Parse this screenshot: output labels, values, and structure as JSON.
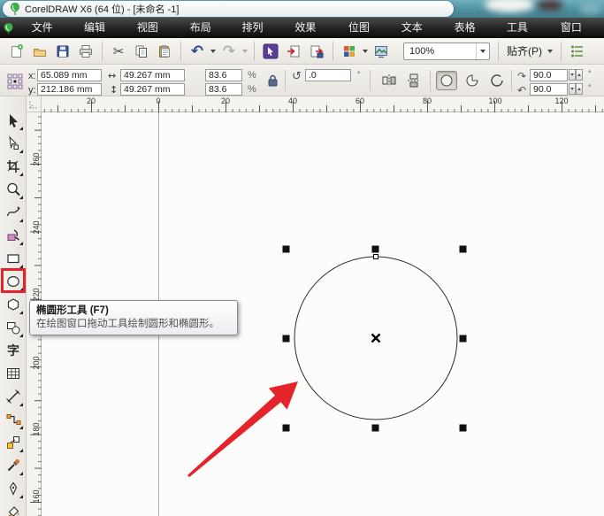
{
  "window": {
    "title": "CorelDRAW X6 (64 位) - [未命名 -1]"
  },
  "menu": {
    "items": [
      "文件(F)",
      "编辑(E)",
      "视图(V)",
      "布局(L)",
      "排列(A)",
      "效果(C)",
      "位图(B)",
      "文本(X)",
      "表格(T)",
      "工具(O)",
      "窗口(W)"
    ]
  },
  "toolbar": {
    "zoom_value": "100%",
    "snap_label": "贴齐(P)"
  },
  "icons": {
    "undo_glyph": "↶",
    "redo_glyph": "↷",
    "cut_glyph": "✂",
    "rotate_glyph": "↺",
    "angle_start_glyph": "↷",
    "angle_end_glyph": "↶",
    "width_glyph": "↔",
    "height_glyph": "↕"
  },
  "propbar": {
    "x_label": "x:",
    "y_label": "y:",
    "x_value": "65.089 mm",
    "y_value": "212.186 mm",
    "width_value": "49.267 mm",
    "height_value": "49.267 mm",
    "scale_h": "83.6",
    "scale_v": "83.6",
    "percent": "%",
    "rotation_value": ".0",
    "degree": "°",
    "start_angle": "90.0",
    "end_angle": "90.0"
  },
  "rulers": {
    "h": [
      "20",
      "0",
      "20",
      "40",
      "60",
      "80",
      "100",
      "120"
    ],
    "v": [
      "260",
      "240",
      "220",
      "200",
      "180",
      "160"
    ]
  },
  "toolbox": {
    "text_tool_glyph": "字",
    "highlighted_tool": "ellipse-tool"
  },
  "tooltip": {
    "title": "椭圆形工具 (F7)",
    "body": "在绘图窗口拖动工具绘制圆形和椭圆形。"
  },
  "colors": {
    "accent_red": "#e3242b",
    "titlebar_teal": "#4d8d9d",
    "menu_bg": "#1a1a1a",
    "handle": "#111111"
  }
}
